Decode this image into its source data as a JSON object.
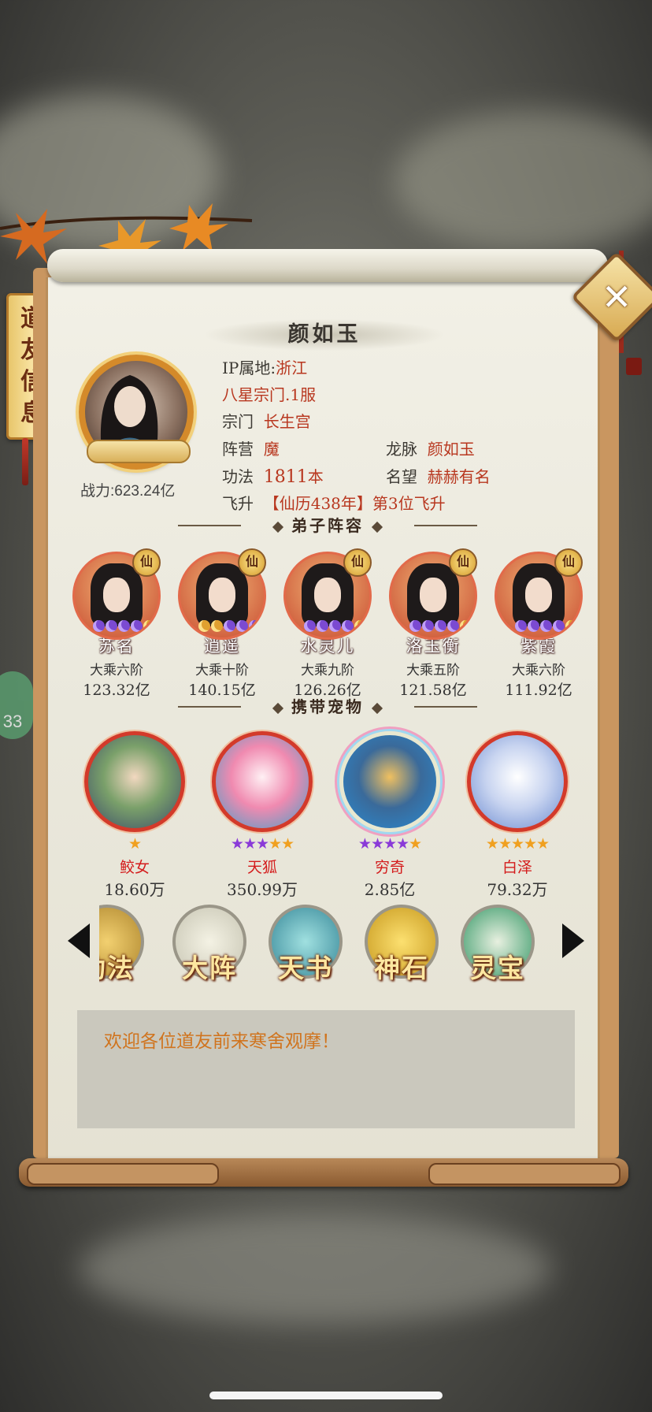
{
  "side_tab": {
    "chars": [
      "道",
      "友",
      "信",
      "息"
    ]
  },
  "close_label": "✕",
  "profile": {
    "name": "颜如玉",
    "power": "战力:623.24亿",
    "ip_label": "IP属地:",
    "ip_value": "浙江",
    "server": "八星宗门.1服",
    "sect_label": "宗门",
    "sect_value": "长生宫",
    "camp_label": "阵营",
    "camp_value": "魔",
    "dragon_label": "龙脉",
    "dragon_value": "颜如玉",
    "skill_label": "功法",
    "skill_value": "1811",
    "skill_unit": "本",
    "fame_label": "名望",
    "fame_value": "赫赫有名",
    "ascend_label": "飞升",
    "ascend_value": "【仙历438年】第3位飞升"
  },
  "sections": {
    "disciples": "弟子阵容",
    "pets": "携带宠物"
  },
  "disciples": [
    {
      "name": "苏名",
      "rank": "大乘六阶",
      "power": "123.32亿",
      "badge": "仙",
      "moons": [
        "p",
        "p",
        "p",
        "p",
        "g"
      ]
    },
    {
      "name": "逍遥",
      "rank": "大乘十阶",
      "power": "140.15亿",
      "badge": "仙",
      "moons": [
        "g",
        "g",
        "p",
        "p",
        "p"
      ]
    },
    {
      "name": "水灵儿",
      "rank": "大乘九阶",
      "power": "126.26亿",
      "badge": "仙",
      "moons": [
        "p",
        "p",
        "p",
        "p",
        "g"
      ]
    },
    {
      "name": "洛玉衡",
      "rank": "大乘五阶",
      "power": "121.58亿",
      "badge": "仙",
      "moons": [
        "p",
        "p",
        "p",
        "p",
        "g"
      ]
    },
    {
      "name": "紫霞",
      "rank": "大乘六阶",
      "power": "111.92亿",
      "badge": "仙",
      "moons": [
        "p",
        "p",
        "p",
        "p",
        "g"
      ]
    }
  ],
  "pets": [
    {
      "name": "鲛女",
      "power": "18.60万",
      "stars": [
        "g"
      ]
    },
    {
      "name": "天狐",
      "power": "350.99万",
      "stars": [
        "p",
        "p",
        "p",
        "g",
        "g"
      ]
    },
    {
      "name": "穷奇",
      "power": "2.85亿",
      "stars": [
        "p",
        "p",
        "p",
        "p",
        "g"
      ]
    },
    {
      "name": "白泽",
      "power": "79.32万",
      "stars": [
        "g",
        "g",
        "g",
        "g",
        "g"
      ]
    }
  ],
  "tools": [
    "功法",
    "大阵",
    "天书",
    "神石",
    "灵宝"
  ],
  "message": "欢迎各位道友前来寒舍观摩！",
  "side_badge": "33"
}
